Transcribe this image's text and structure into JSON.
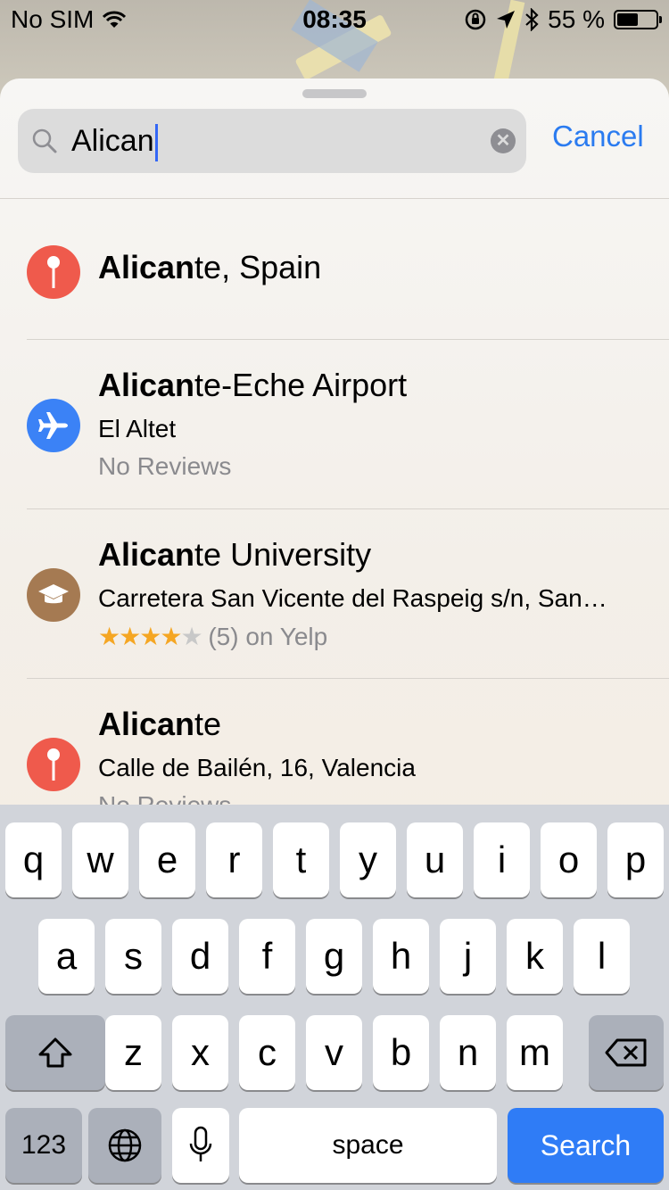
{
  "status_bar": {
    "carrier": "No SIM",
    "time": "08:35",
    "battery_percent": "55 %",
    "battery_level": 0.55
  },
  "search": {
    "query": "Alican",
    "cancel_label": "Cancel"
  },
  "results": [
    {
      "title_match": "Alican",
      "title_rest": "te, Spain",
      "subtitle": "",
      "meta": "",
      "icon": "pin-icon",
      "icon_color": "#ef5a4c"
    },
    {
      "title_match": "Alican",
      "title_rest": "te-Eche Airport",
      "subtitle": "El Altet",
      "meta": "No Reviews",
      "icon": "airplane-icon",
      "icon_color": "#3b82f6"
    },
    {
      "title_match": "Alican",
      "title_rest": "te University",
      "subtitle": "Carretera San Vicente del Raspeig s/n, San…",
      "meta": "(5) on Yelp",
      "rating": 4,
      "rating_max": 5,
      "icon": "graduation-cap-icon",
      "icon_color": "#a57a52"
    },
    {
      "title_match": "Alican",
      "title_rest": "te",
      "subtitle": "Calle de Bailén, 16, Valencia",
      "meta": "No Reviews",
      "icon": "pin-icon",
      "icon_color": "#ef5a4c"
    }
  ],
  "keyboard": {
    "row1": [
      "q",
      "w",
      "e",
      "r",
      "t",
      "y",
      "u",
      "i",
      "o",
      "p"
    ],
    "row2": [
      "a",
      "s",
      "d",
      "f",
      "g",
      "h",
      "j",
      "k",
      "l"
    ],
    "row3": [
      "z",
      "x",
      "c",
      "v",
      "b",
      "n",
      "m"
    ],
    "numbers_label": "123",
    "space_label": "space",
    "search_label": "Search",
    "shift_icon": "shift-icon",
    "delete_icon": "backspace-icon",
    "globe_icon": "globe-icon",
    "mic_icon": "microphone-icon"
  },
  "colors": {
    "accent": "#2a7bf0",
    "search_key": "#2f7cf6"
  }
}
